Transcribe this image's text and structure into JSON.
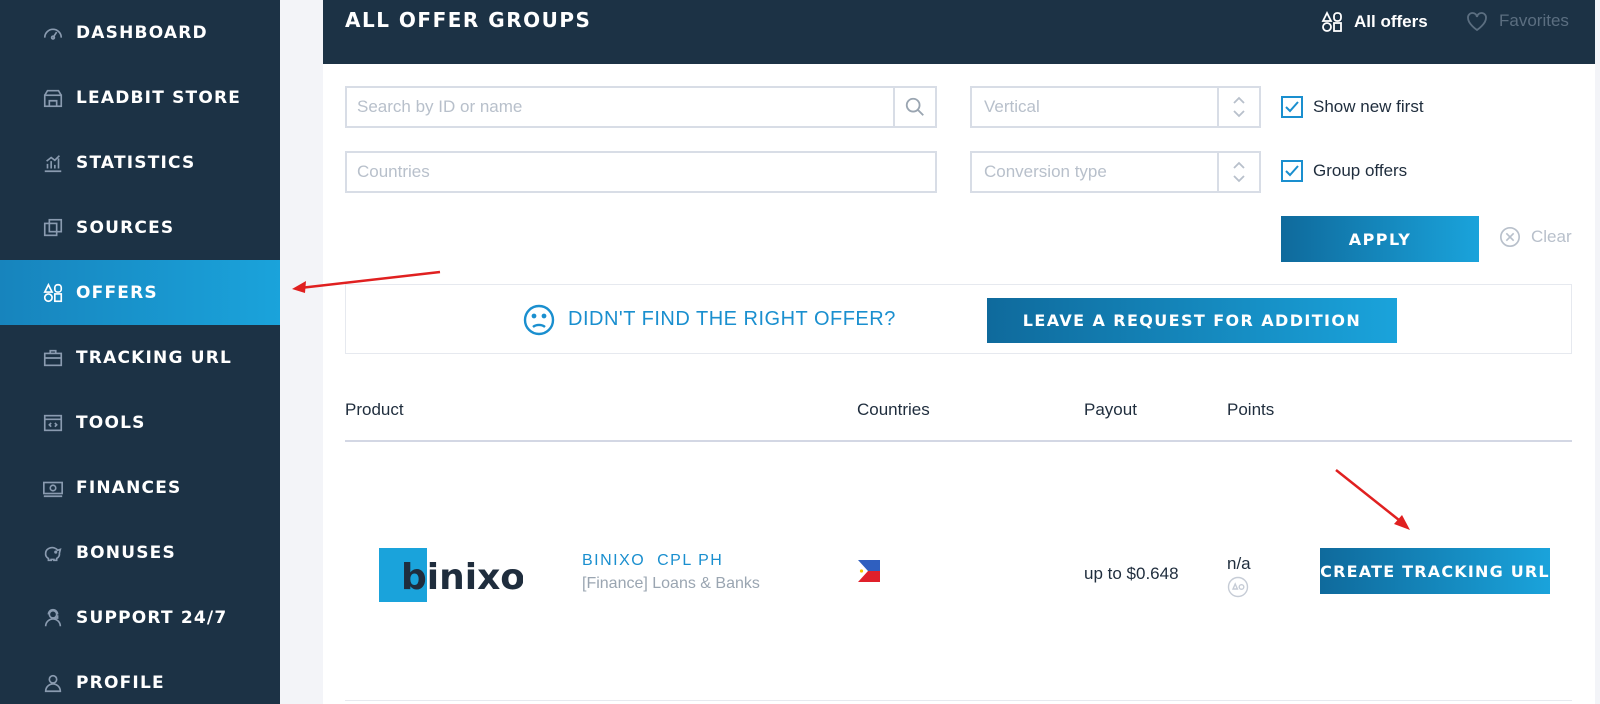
{
  "sidebar": {
    "items": [
      {
        "label": "DASHBOARD",
        "icon": "dashboard-icon"
      },
      {
        "label": "LEADBIT STORE",
        "icon": "store-icon"
      },
      {
        "label": "STATISTICS",
        "icon": "statistics-icon"
      },
      {
        "label": "SOURCES",
        "icon": "sources-icon"
      },
      {
        "label": "OFFERS",
        "icon": "offers-icon",
        "active": true
      },
      {
        "label": "TRACKING URL",
        "icon": "briefcase-icon"
      },
      {
        "label": "TOOLS",
        "icon": "code-window-icon"
      },
      {
        "label": "FINANCES",
        "icon": "money-icon"
      },
      {
        "label": "BONUSES",
        "icon": "piggy-bank-icon"
      },
      {
        "label": "SUPPORT 24/7",
        "icon": "support-icon"
      },
      {
        "label": "PROFILE",
        "icon": "user-icon"
      }
    ]
  },
  "header": {
    "title": "ALL OFFER GROUPS",
    "tabs": [
      {
        "label": "All offers",
        "icon": "offers-grid-icon",
        "active": true
      },
      {
        "label": "Favorites",
        "icon": "heart-icon",
        "active": false
      }
    ]
  },
  "filters": {
    "search_placeholder": "Search by ID or name",
    "countries_placeholder": "Countries",
    "vertical_placeholder": "Vertical",
    "conversion_placeholder": "Conversion type",
    "show_new_first": "Show new first",
    "group_offers": "Group offers",
    "apply_label": "APPLY",
    "clear_label": "Clear"
  },
  "banner": {
    "text": "DIDN'T FIND THE RIGHT OFFER?",
    "button_label": "LEAVE A REQUEST FOR ADDITION"
  },
  "table": {
    "headers": [
      "Product",
      "Countries",
      "Payout",
      "Points"
    ],
    "rows": [
      {
        "logo_text": "binixo",
        "name": "BINIXO  CPL PH",
        "category": "[Finance] Loans & Banks",
        "country_flag": "philippines-flag",
        "payout": "up to $0.648",
        "points": "n/a",
        "button_label": "CREATE TRACKING URL"
      }
    ]
  },
  "colors": {
    "sidebar_bg": "#1c3245",
    "accent": "#1a8fcf",
    "active_gradient_start": "#1784bd",
    "active_gradient_end": "#1aa3db",
    "annotation_arrow": "#e02020"
  }
}
